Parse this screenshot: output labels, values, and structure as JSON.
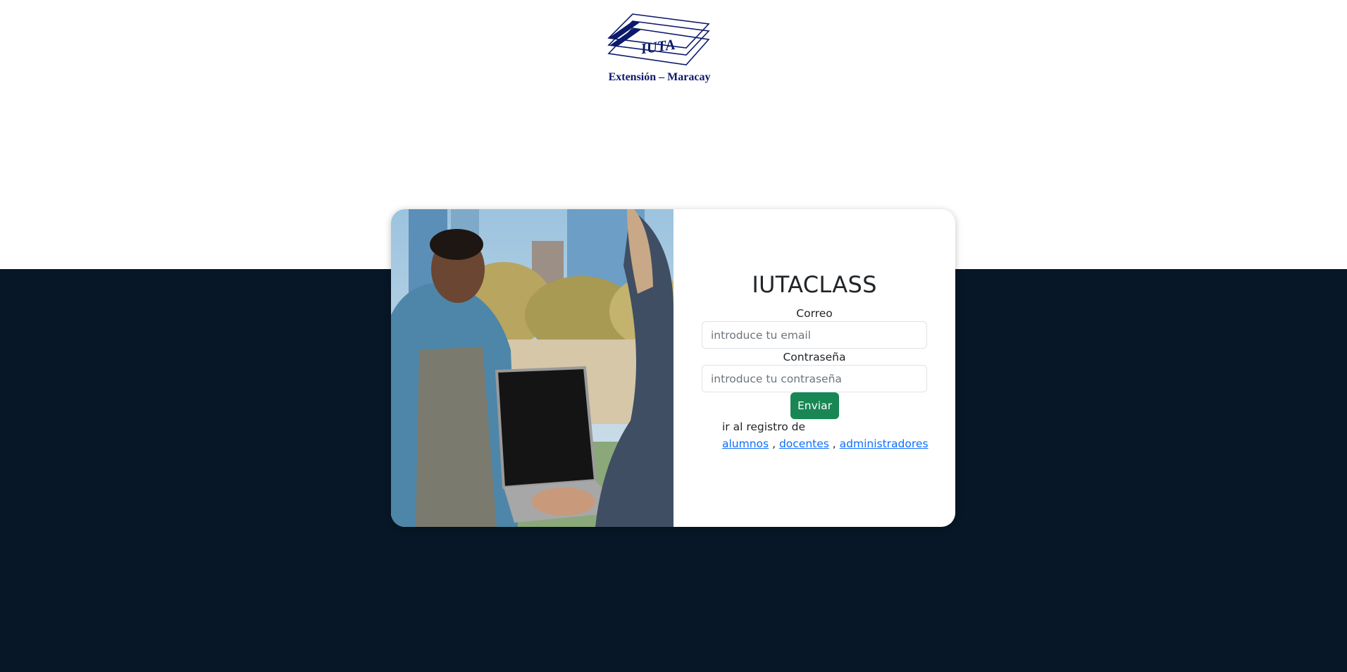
{
  "logo": {
    "text": "IUTA",
    "caption": "Extensión – Maracay",
    "color": "#0c1a6b"
  },
  "colors": {
    "background_top": "#ffffff",
    "background_bottom": "#071727",
    "accent_button": "#198754",
    "link": "#0d6efd"
  },
  "card": {
    "image_alt": "students-with-laptop-photo",
    "title": "IUTACLASS",
    "email_label": "Correo",
    "email_placeholder": "introduce tu email",
    "email_value": "",
    "password_label": "Contraseña",
    "password_placeholder": "introduce tu contraseña",
    "password_value": "",
    "submit_label": "Enviar",
    "register_text": "ir al registro de",
    "register_links": [
      {
        "label": "alumnos"
      },
      {
        "label": "docentes"
      },
      {
        "label": "administradores"
      }
    ],
    "separator": ","
  }
}
